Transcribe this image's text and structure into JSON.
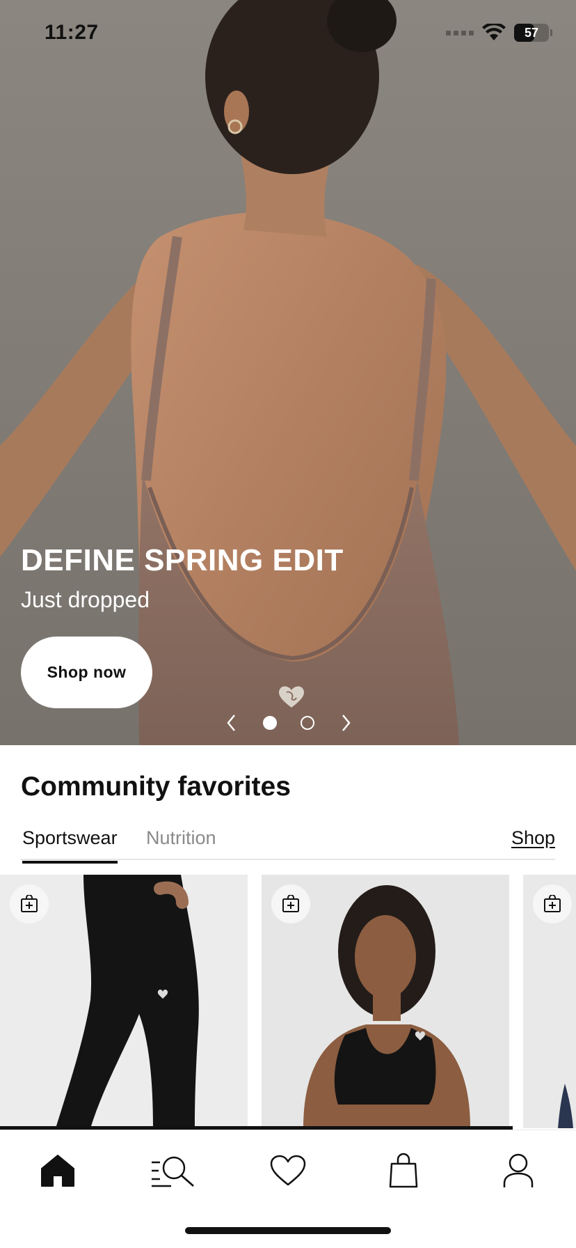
{
  "status_bar": {
    "time": "11:27",
    "battery": "57"
  },
  "hero": {
    "title": "DEFINE SPRING EDIT",
    "subtitle": "Just dropped",
    "cta_label": "Shop now",
    "carousel": {
      "slides": 2,
      "active_index": 0
    }
  },
  "community": {
    "title": "Community favorites",
    "tabs": [
      {
        "label": "Sportswear",
        "active": true
      },
      {
        "label": "Nutrition",
        "active": false
      }
    ],
    "shop_link": "Shop",
    "products": [
      {
        "image": "black-leggings",
        "add_icon": "add-to-bag-icon"
      },
      {
        "image": "black-sports-bra",
        "add_icon": "add-to-bag-icon"
      },
      {
        "image": "partial-product",
        "add_icon": "add-to-bag-icon"
      }
    ]
  },
  "nav": {
    "items": [
      {
        "icon": "home-icon",
        "active": true
      },
      {
        "icon": "search-icon",
        "active": false
      },
      {
        "icon": "heart-icon",
        "active": false
      },
      {
        "icon": "bag-icon",
        "active": false
      },
      {
        "icon": "profile-icon",
        "active": false
      }
    ]
  },
  "colors": {
    "hero_background": "#7f7a74",
    "garment": "#8b6e62",
    "skin": "#b98764",
    "text_dark": "#111111",
    "inactive_text": "#8a8a8a"
  }
}
